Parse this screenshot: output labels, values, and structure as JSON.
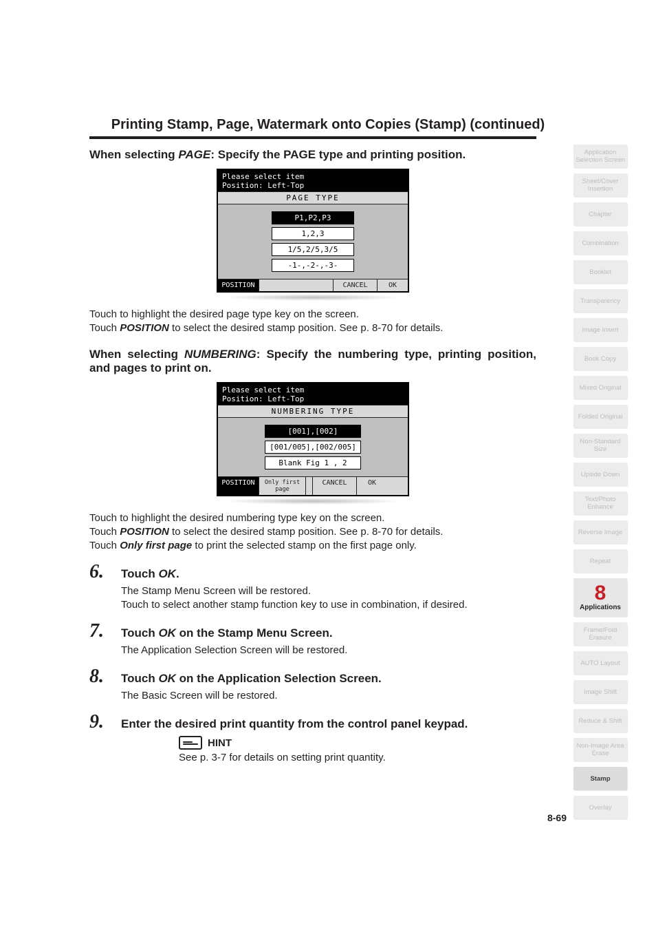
{
  "header": {
    "title": "Printing Stamp, Page, Watermark onto Copies (Stamp) (continued)"
  },
  "section_page": {
    "heading_pre": "When selecting ",
    "heading_em": "PAGE",
    "heading_post": ": Specify the PAGE type and printing position.",
    "lcd": {
      "line1": "Please select item",
      "line2": "Position: Left-Top",
      "section_label": "PAGE TYPE",
      "options": [
        "P1,P2,P3",
        "1,2,3",
        "1/5,2/5,3/5",
        "-1-,-2-,-3-"
      ],
      "selected_index": 0,
      "bottom": {
        "position": "POSITION",
        "cancel": "CANCEL",
        "ok": "OK"
      }
    },
    "para1": "Touch to highlight the desired page type key on the screen.",
    "para2_pre": "Touch ",
    "para2_em": "POSITION",
    "para2_post": " to select the desired stamp position. See p. 8-70 for details."
  },
  "section_numbering": {
    "heading_pre": "When selecting ",
    "heading_em": "NUMBERING",
    "heading_post": ": Specify the numbering type, printing position, and pages to print on.",
    "lcd": {
      "line1": "Please select item",
      "line2": "Position: Left-Top",
      "section_label": "NUMBERING TYPE",
      "options": [
        "[001],[002]",
        "[001/005],[002/005]",
        "Blank Fig 1 , 2"
      ],
      "selected_index": 0,
      "bottom": {
        "position": "POSITION",
        "first_page": "Only first page",
        "cancel": "CANCEL",
        "ok": "OK"
      }
    },
    "para1": "Touch to highlight the desired numbering type key on the screen.",
    "para2_pre": "Touch ",
    "para2_em": "POSITION",
    "para2_post": " to select the desired stamp position. See p. 8-70 for details.",
    "para3_pre": "Touch ",
    "para3_em": "Only first page",
    "para3_post": " to print the selected stamp on the first page only."
  },
  "steps": [
    {
      "num": "6.",
      "title_pre": "Touch ",
      "title_em": "OK",
      "title_post": ".",
      "body": [
        "The Stamp Menu Screen will be restored.",
        "Touch to select another stamp function key to use in combination, if desired."
      ]
    },
    {
      "num": "7.",
      "title_pre": "Touch ",
      "title_em": "OK",
      "title_post": " on the Stamp Menu Screen.",
      "body": [
        "The Application Selection Screen will be restored."
      ]
    },
    {
      "num": "8.",
      "title_pre": "Touch ",
      "title_em": "OK",
      "title_post": " on the Application Selection Screen.",
      "body": [
        "The Basic Screen will be restored."
      ]
    },
    {
      "num": "9.",
      "title_pre": "Enter the desired print quantity from the control panel keypad.",
      "title_em": "",
      "title_post": "",
      "body": []
    }
  ],
  "hint": {
    "label": "HINT",
    "text": "See p. 3-7 for details on setting print quantity."
  },
  "page_number": "8-69",
  "sidebar": {
    "items_top": [
      "Application Selection Screen",
      "Sheet/Cover Insertion",
      "Chapter",
      "Combination",
      "Booklet",
      "Transparency",
      "Image Insert",
      "Book Copy",
      "Mixed Original",
      "Folded Original",
      "Non-Standard Size",
      "Upside Down",
      "Text/Photo Enhance",
      "Reverse Image",
      "Repeat"
    ],
    "badge": {
      "number": "8",
      "label": "Applications"
    },
    "items_bottom": [
      "Frame/Fold Erasure",
      "AUTO Layout",
      "Image Shift",
      "Reduce & Shift",
      "Non-Image Area Erase",
      "Stamp",
      "Overlay"
    ]
  }
}
